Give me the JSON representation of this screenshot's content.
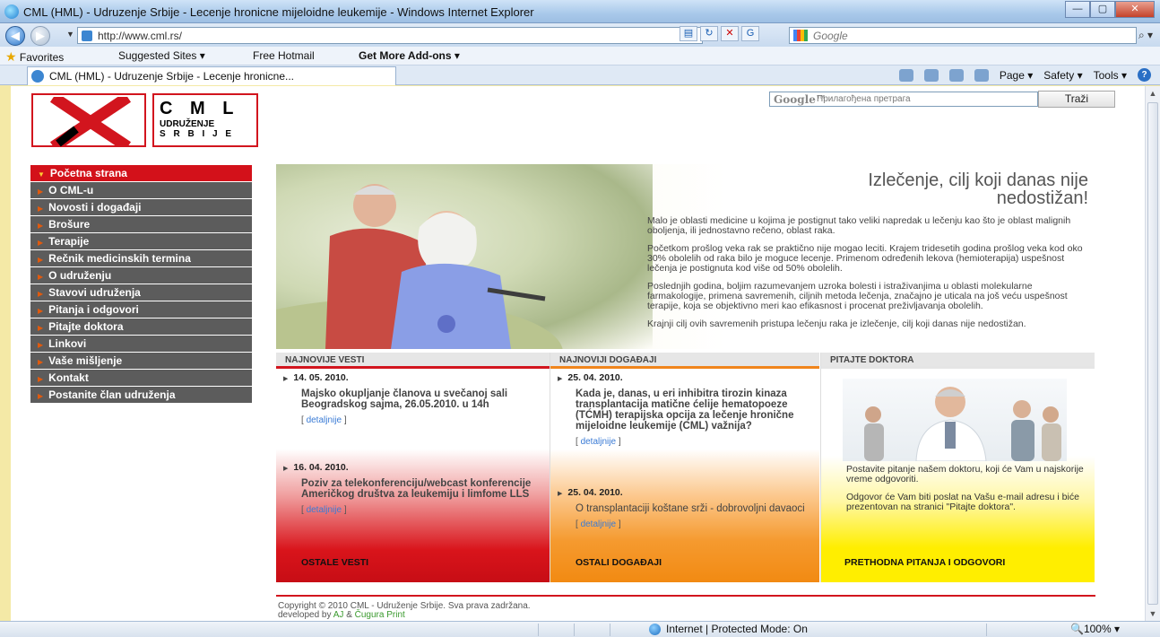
{
  "window": {
    "title": "CML (HML) - Udruzenje Srbije - Lecenje hronicne mijeloidne leukemije - Windows Internet Explorer",
    "minimize": "—",
    "maximize": "▢",
    "close": "✕"
  },
  "address_bar": {
    "url": "http://www.cml.rs/",
    "search_placeholder": "Google",
    "search_go": "⌕ ▾"
  },
  "favorites_bar": {
    "favorites_label": "Favorites",
    "suggested_sites": "Suggested Sites ▾",
    "free_hotmail": "Free Hotmail",
    "get_more_addons": "Get More Add-ons ▾"
  },
  "tab": {
    "label": "CML (HML) - Udruzenje Srbije - Lecenje hronicne..."
  },
  "command_bar": {
    "page": "Page ▾",
    "safety": "Safety ▾",
    "tools": "Tools ▾"
  },
  "site": {
    "logo": {
      "title": "C M L",
      "line1": "UDRUŽENJE",
      "line2": "S R B I J E"
    },
    "search": {
      "logo_text": "Google™",
      "placeholder": "Прилагођена претрага",
      "button": "Traži"
    },
    "menu": [
      {
        "label": "Početna strana",
        "active": true
      },
      {
        "label": "O CML-u"
      },
      {
        "label": "Novosti i događaji"
      },
      {
        "label": "Brošure"
      },
      {
        "label": "Terapije"
      },
      {
        "label": "Rečnik medicinskih termina"
      },
      {
        "label": "O udruženju"
      },
      {
        "label": "Stavovi udruženja"
      },
      {
        "label": "Pitanja i odgovori"
      },
      {
        "label": "Pitajte doktora"
      },
      {
        "label": "Linkovi"
      },
      {
        "label": "Vaše mišljenje"
      },
      {
        "label": "Kontakt"
      },
      {
        "label": "Postanite član udruženja"
      }
    ],
    "hero": {
      "title_line1": "Izlečenje, cilj koji danas nije",
      "title_line2": "nedostižan!",
      "p1": "Malo je oblasti medicine u kojima je postignut tako veliki napredak u lečenju kao što je oblast malignih oboljenja, ili jednostavno rečeno, oblast raka.",
      "p2": "Početkom prošlog veka rak se praktično nije mogao leciti. Krajem tridesetih godina prošlog veka kod oko 30% obolelih od raka bilo je moguce lecenje. Primenom određenih lekova (hemioterapija) uspešnost lečenja je postignuta kod više od 50% obolelih.",
      "p3": "Poslednjih godina, boljim razumevanjem uzroka bolesti i istraživanjima u oblasti molekularne farmakologije, primena savremenih, ciljnih metoda lečenja, značajno je uticala na još veću uspešnost terapije, koja se objektivno meri kao efikasnost i procenat preživljavanja obolelih.",
      "p4": "Krajnji cilj ovih savremenih pristupa lečenju raka je izlečenje, cilj koji danas nije nedostižan."
    },
    "news": {
      "heading": "NAJNOVIJE VESTI",
      "items": [
        {
          "date": "14. 05. 2010.",
          "text": "Majsko okupljanje članova u svečanoj sali Beogradskog sajma, 26.05.2010. u 14h",
          "more": "detaljnije"
        },
        {
          "date": "16. 04. 2010.",
          "text": "Poziv za telekonferenciju/webcast konferencije Američkog društva za leukemiju i limfome LLS",
          "more": "detaljnije"
        }
      ],
      "footer": "OSTALE VESTI"
    },
    "events": {
      "heading": "NAJNOVIJI DOGAĐAJI",
      "items": [
        {
          "date": "25. 04. 2010.",
          "text": "Kada je, danas, u eri inhibitra tirozin kinaza transplantacija matične ćelije hematopoeze (TĆMH) terapijska opcija za lečenje hronične mijeloidne leukemije (CML) važnija?",
          "more": "detaljnije"
        },
        {
          "date": "25. 04. 2010.",
          "text": "O transplantaciji koštane srži - dobrovoljni davaoci",
          "more": "detaljnije"
        }
      ],
      "footer": "OSTALI DOGAĐAJI"
    },
    "ask": {
      "heading": "PITAJTE DOKTORA",
      "p1": "Postavite pitanje našem doktoru, koji će Vam u najskorije vreme odgovoriti.",
      "p2": "Odgovor će Vam biti poslat na Vašu e-mail adresu i biće prezentovan na stranici \"Pitajte doktora\".",
      "footer": "PRETHODNA PITANJA I ODGOVORI"
    },
    "footer": {
      "copyright": "Copyright © 2010 CML - Udruženje Srbije. Sva prava zadržana.",
      "developed_by": "developed by",
      "dev1": "AJ",
      "amp": "&",
      "dev2": "Čugura Print"
    }
  },
  "status_bar": {
    "zone": "Internet | Protected Mode: On",
    "zoom": "🔍100%  ▾"
  }
}
